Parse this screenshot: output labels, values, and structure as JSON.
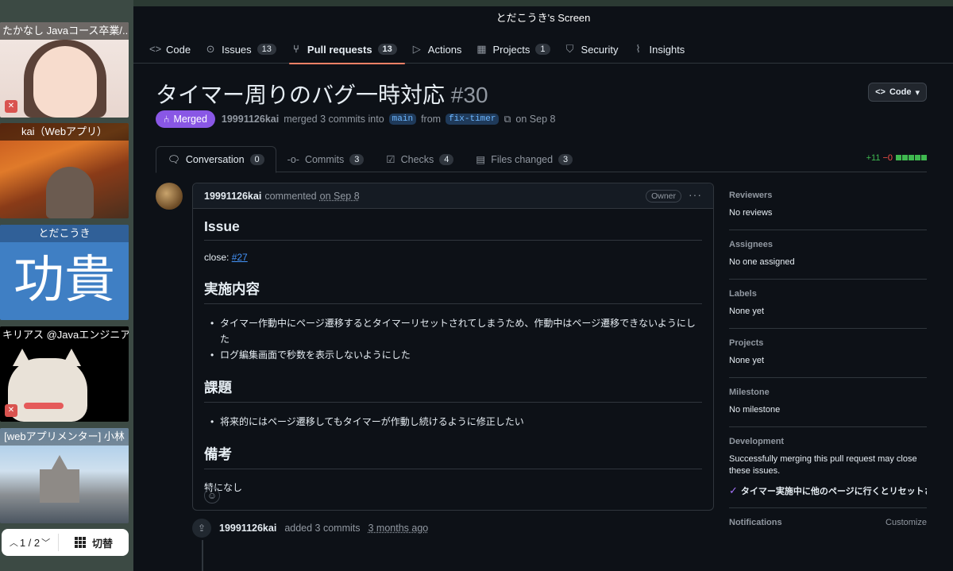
{
  "participants": [
    {
      "name": "たかなし Javaコース卒業/..."
    },
    {
      "name": "kai（Webアプリ）"
    },
    {
      "name": "とだこうき",
      "big_text": "功貴"
    },
    {
      "name": "キリアス @Javaエンジニア"
    },
    {
      "name": "[webアプリメンター] 小林"
    }
  ],
  "pager": {
    "page": "1 / 2",
    "switch_label": "切替"
  },
  "screen": {
    "title": "とだこうき's Screen",
    "repo_nav": [
      {
        "label": "Code",
        "icon": "code-icon"
      },
      {
        "label": "Issues",
        "count": "13",
        "icon": "issue-icon"
      },
      {
        "label": "Pull requests",
        "count": "13",
        "icon": "pull-request-icon"
      },
      {
        "label": "Actions",
        "icon": "play-icon"
      },
      {
        "label": "Projects",
        "count": "1",
        "icon": "table-icon"
      },
      {
        "label": "Security",
        "icon": "shield-icon"
      },
      {
        "label": "Insights",
        "icon": "graph-icon"
      }
    ],
    "pr": {
      "title": "タイマー周りのバグ一時対応",
      "number": "#30",
      "code_button": "Code",
      "state": "Merged",
      "author": "19991126kai",
      "merge_text": "merged 3 commits into",
      "base": "main",
      "from_text": "from",
      "head": "fix-timer",
      "date": "on Sep 8"
    },
    "tabs": [
      {
        "label": "Conversation",
        "count": "0"
      },
      {
        "label": "Commits",
        "count": "3"
      },
      {
        "label": "Checks",
        "count": "4"
      },
      {
        "label": "Files changed",
        "count": "3"
      }
    ],
    "diffstat": {
      "additions": "+11",
      "deletions": "−0"
    },
    "comment": {
      "author": "19991126kai",
      "action": "commented",
      "date": "on Sep 8",
      "badge": "Owner",
      "h_issue": "Issue",
      "close_label": "close:",
      "close_link": "#27",
      "h_impl": "実施内容",
      "impl_items": [
        "タイマー作動中にページ遷移するとタイマーリセットされてしまうため、作動中はページ遷移できないようにした",
        "ログ編集画面で秒数を表示しないようにした"
      ],
      "h_task": "課題",
      "task_items": [
        "将来的にはページ遷移してもタイマーが作動し続けるように修正したい"
      ],
      "h_notes": "備考",
      "notes": "特になし"
    },
    "timeline": {
      "author": "19991126kai",
      "text": "added 3 commits",
      "ago": "3 months ago"
    },
    "sidebar": {
      "reviewers": {
        "head": "Reviewers",
        "val": "No reviews"
      },
      "assignees": {
        "head": "Assignees",
        "val": "No one assigned"
      },
      "labels": {
        "head": "Labels",
        "val": "None yet"
      },
      "projects": {
        "head": "Projects",
        "val": "None yet"
      },
      "milestone": {
        "head": "Milestone",
        "val": "No milestone"
      },
      "development": {
        "head": "Development",
        "val": "Successfully merging this pull request may close these issues.",
        "issue": "タイマー実施中に他のページに行くとリセットさ..."
      },
      "notifications": {
        "head": "Notifications",
        "customize": "Customize"
      }
    }
  }
}
